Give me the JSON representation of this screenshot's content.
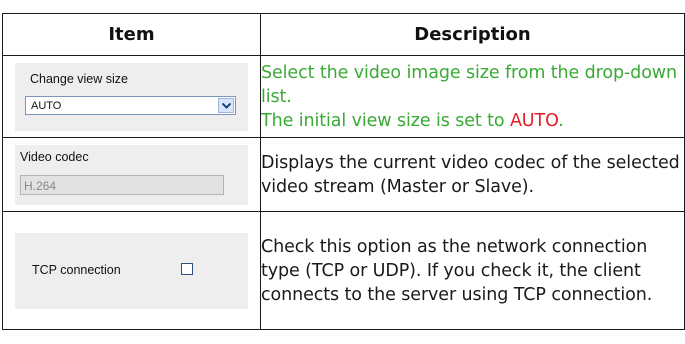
{
  "table": {
    "headers": {
      "item": "Item",
      "description": "Description"
    },
    "rows": [
      {
        "item_label": "Change view size",
        "select_value": "AUTO",
        "desc_line1": "Select the video image size from the drop-down list.",
        "desc_line2_prefix": "The initial view size is set to ",
        "desc_line2_value": "AUTO",
        "desc_line2_suffix": "."
      },
      {
        "item_label": "Video codec",
        "field_value": "H.264",
        "description": "Displays the current video codec of the selected video stream (Master or Slave)."
      },
      {
        "item_label": "TCP connection",
        "checkbox_checked": false,
        "description": "Check this option as the network connection type (TCP or UDP). If you check it, the client connects to the server using TCP connection."
      }
    ]
  },
  "colors": {
    "green_text": "#3aaa35",
    "red_text": "#e31e24"
  },
  "icons": {
    "dropdown": "chevron-down-icon"
  }
}
